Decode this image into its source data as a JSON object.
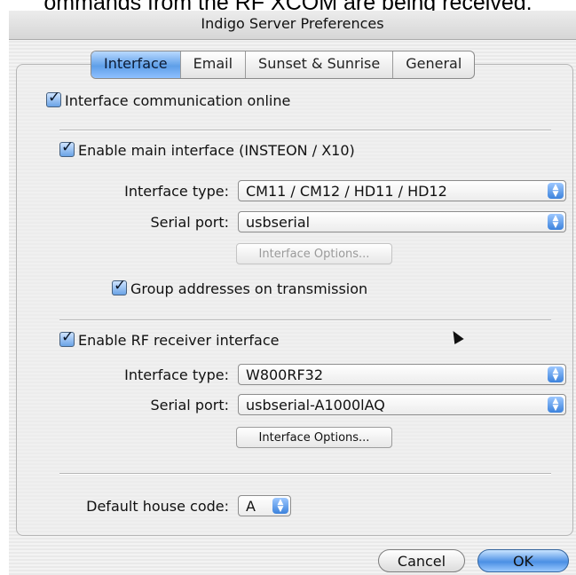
{
  "caption": "ommands from the RF XCOM are being received.",
  "window": {
    "title": "Indigo Server Preferences"
  },
  "tabs": [
    {
      "label": "Interface",
      "active": true
    },
    {
      "label": "Email",
      "active": false
    },
    {
      "label": "Sunset & Sunrise",
      "active": false
    },
    {
      "label": "General",
      "active": false
    }
  ],
  "interface": {
    "communication_online": {
      "label": "Interface communication online",
      "checked": true
    },
    "main": {
      "enable": {
        "label": "Enable main interface (INSTEON / X10)",
        "checked": true
      },
      "type_label": "Interface type:",
      "type_value": "CM11 / CM12 / HD11 / HD12",
      "port_label": "Serial port:",
      "port_value": "usbserial",
      "options_button": "Interface Options...",
      "group": {
        "label": "Group addresses on transmission",
        "checked": true
      }
    },
    "rf": {
      "enable": {
        "label": "Enable RF receiver interface",
        "checked": true
      },
      "type_label": "Interface type:",
      "type_value": "W800RF32",
      "port_label": "Serial port:",
      "port_value": "usbserial-A1000lAQ",
      "options_button": "Interface Options..."
    },
    "house_code": {
      "label": "Default house code:",
      "value": "A"
    }
  },
  "footer": {
    "cancel": "Cancel",
    "ok": "OK"
  },
  "colors": {
    "accent": "#5f9fe8",
    "checkbox": "#6aa3e6"
  }
}
